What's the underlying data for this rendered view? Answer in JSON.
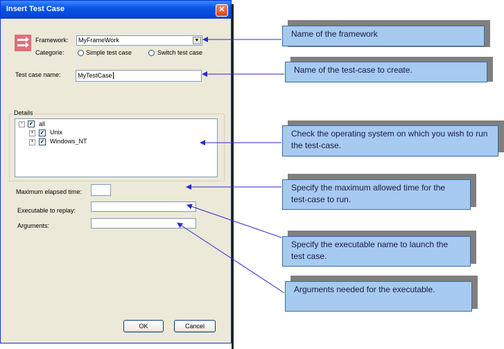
{
  "dialog": {
    "title": "Insert Test Case",
    "close_glyph": "✕",
    "framework_label": "Framework:",
    "framework_value": "MyFrameWork",
    "category_label": "Categorie:",
    "radio_simple_label": "Simple test case",
    "radio_switch_label": "Switch test case",
    "testcase_label": "Test case name:",
    "testcase_value": "MyTestCase",
    "details_label": "Details",
    "tree": [
      {
        "label": "all",
        "expander": "−",
        "checked": true
      },
      {
        "label": "Unix",
        "expander": "+",
        "checked": true
      },
      {
        "label": "Windows_NT",
        "expander": "+",
        "checked": true
      }
    ],
    "max_elapsed_label": "Maximum elapsed time:",
    "max_elapsed_value": "",
    "executable_label": "Executable to replay:",
    "executable_value": "",
    "arguments_label": "Arguments:",
    "arguments_value": "",
    "ok_label": "OK",
    "cancel_label": "Cancel",
    "check_glyph": "✓"
  },
  "callouts": [
    "Name of the framework",
    "Name of the test-case to create.",
    "Check the operating system on which you wish to run the test-case.",
    "Specify the maximum allowed time for the test-case to run.",
    "Specify the executable name to launch the test case.",
    "Arguments needed for the executable."
  ],
  "colors": {
    "callout_fill": "#a6caf0",
    "arrow": "#2a2ad0",
    "titlebar": "#0a54e6"
  }
}
